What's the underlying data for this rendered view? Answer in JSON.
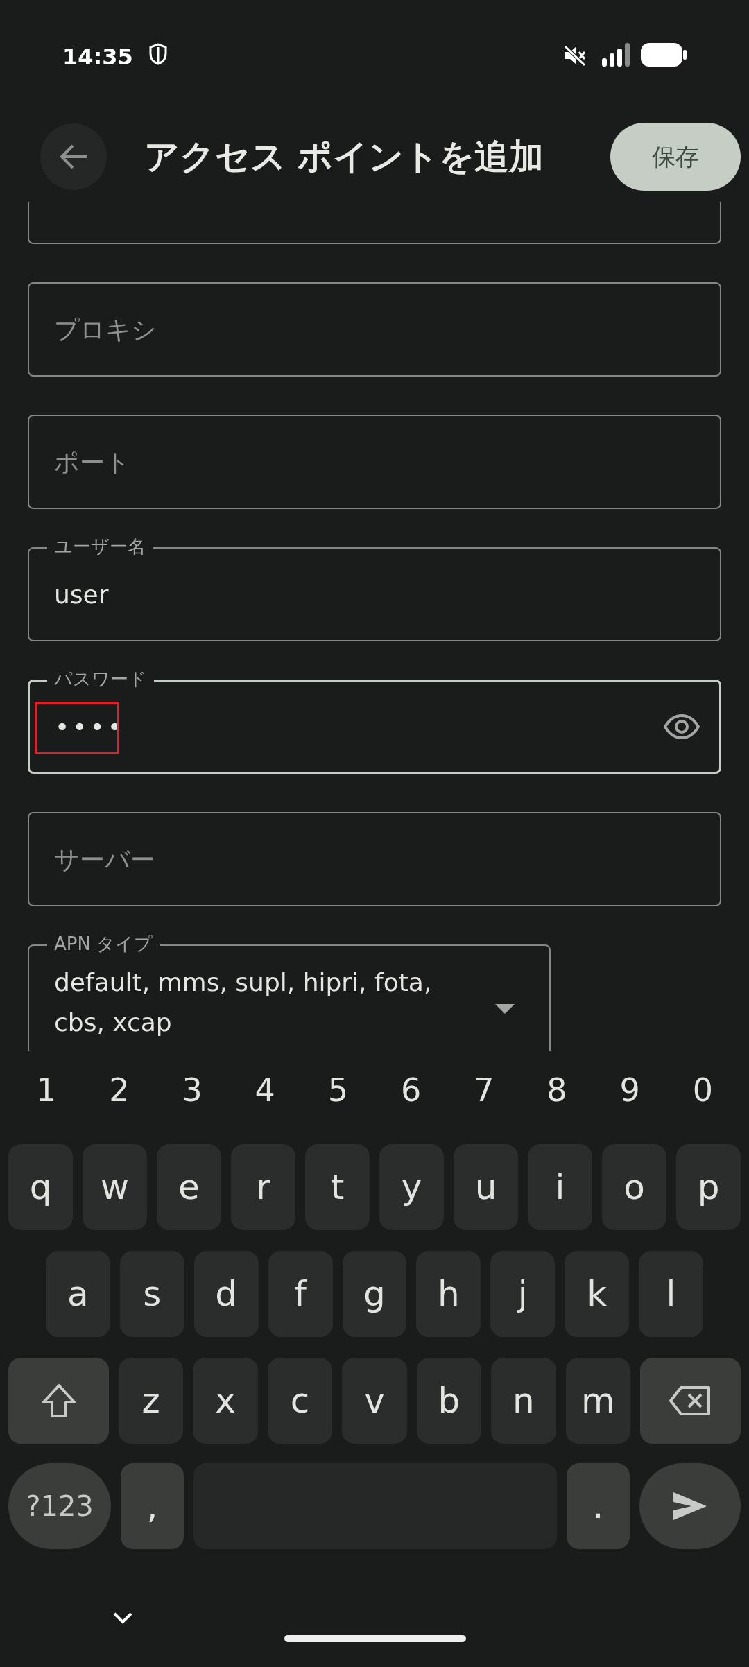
{
  "status_bar": {
    "time": "14:35"
  },
  "header": {
    "title": "アクセス ポイントを追加",
    "save_button": "保存"
  },
  "fields": [
    {
      "kind": "clipped",
      "focused": false
    },
    {
      "kind": "text",
      "placeholder": "プロキシ",
      "focused": false
    },
    {
      "kind": "text",
      "placeholder": "ポート",
      "focused": false
    },
    {
      "kind": "text",
      "label": "ユーザー名",
      "value": "user",
      "focused": false
    },
    {
      "kind": "password",
      "label": "パスワード",
      "value": "••••",
      "focused": true
    },
    {
      "kind": "text",
      "placeholder": "サーバー",
      "focused": false
    },
    {
      "kind": "dropdown",
      "label": "APN タイプ",
      "value": "default, mms, supl, hipri, fota, cbs, xcap",
      "focused": false
    }
  ],
  "keyboard": {
    "number_row": [
      "1",
      "2",
      "3",
      "4",
      "5",
      "6",
      "7",
      "8",
      "9",
      "0"
    ],
    "rows": [
      [
        "q",
        "w",
        "e",
        "r",
        "t",
        "y",
        "u",
        "i",
        "o",
        "p"
      ],
      [
        "a",
        "s",
        "d",
        "f",
        "g",
        "h",
        "j",
        "k",
        "l"
      ],
      [
        "z",
        "x",
        "c",
        "v",
        "b",
        "n",
        "m"
      ]
    ],
    "symbols_key": "?123",
    "comma_key": ",",
    "period_key": "."
  }
}
